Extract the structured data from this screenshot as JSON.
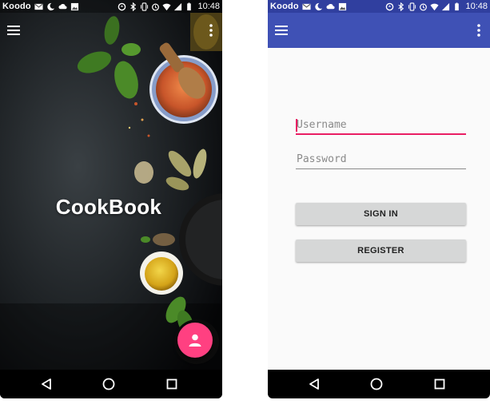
{
  "status_bar": {
    "carrier": "Koodo",
    "time": "10:48",
    "icons": [
      "gmail-icon",
      "moon-icon",
      "cloud-icon",
      "image-icon",
      "sync-icon",
      "bluetooth-icon",
      "vibrate-icon",
      "alarm-icon",
      "wifi-icon",
      "signal-icon",
      "battery-icon"
    ]
  },
  "splash_screen": {
    "title": "CookBook",
    "toolbar_icons": [
      "menu-icon",
      "more-vert-icon"
    ],
    "fab_icon": "person-icon",
    "fab_color": "#ff4081"
  },
  "login_screen": {
    "toolbar_color": "#3f51b5",
    "status_color": "#303f9f",
    "username_placeholder": "Username",
    "password_placeholder": "Password",
    "sign_in_label": "SIGN IN",
    "register_label": "REGISTER",
    "accent_color": "#e91e63"
  },
  "nav_bar": {
    "buttons": [
      "back-icon",
      "home-icon",
      "recents-icon"
    ]
  }
}
